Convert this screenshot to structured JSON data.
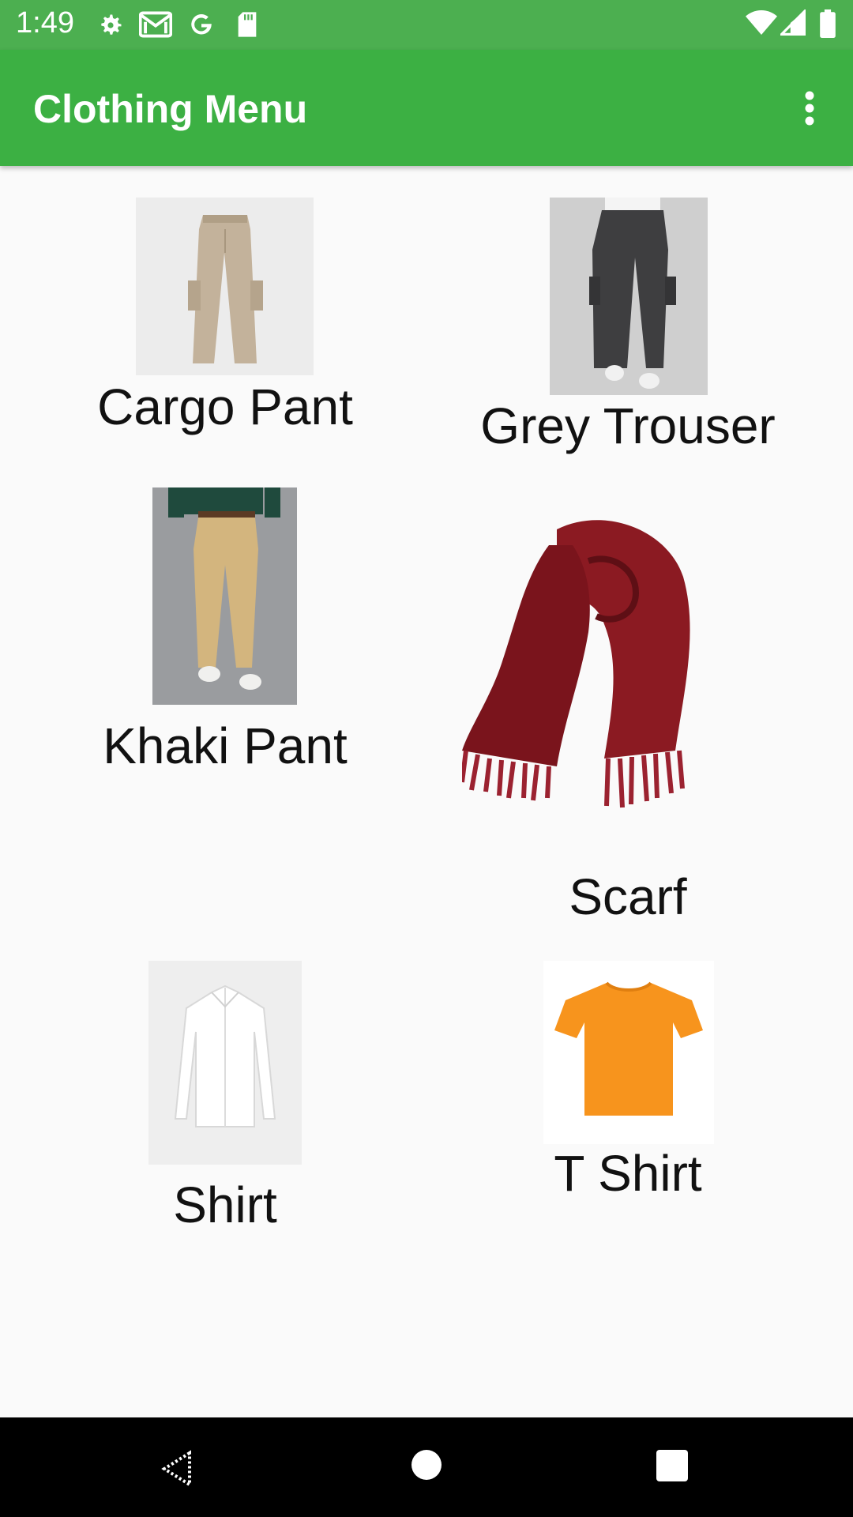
{
  "status_bar": {
    "time": "1:49",
    "icons_left": [
      "settings-icon",
      "gmail-icon",
      "google-icon",
      "sd-card-icon"
    ],
    "icons_right": [
      "wifi-icon",
      "signal-icon",
      "battery-icon"
    ]
  },
  "app_bar": {
    "title": "Clothing Menu",
    "overflow_icon": "more-vert-icon"
  },
  "items": [
    {
      "label": "Cargo Pant"
    },
    {
      "label": "Grey Trouser"
    },
    {
      "label": "Khaki Pant"
    },
    {
      "label": "Scarf"
    },
    {
      "label": "Shirt"
    },
    {
      "label": "T Shirt"
    }
  ],
  "nav_bar": {
    "buttons": [
      "back-icon",
      "home-icon",
      "recents-icon"
    ]
  },
  "colors": {
    "status_bar": "#4caf50",
    "app_bar": "#3cb043",
    "background": "#fafafa",
    "scarf": "#8b1a22",
    "tshirt": "#f7941d"
  }
}
